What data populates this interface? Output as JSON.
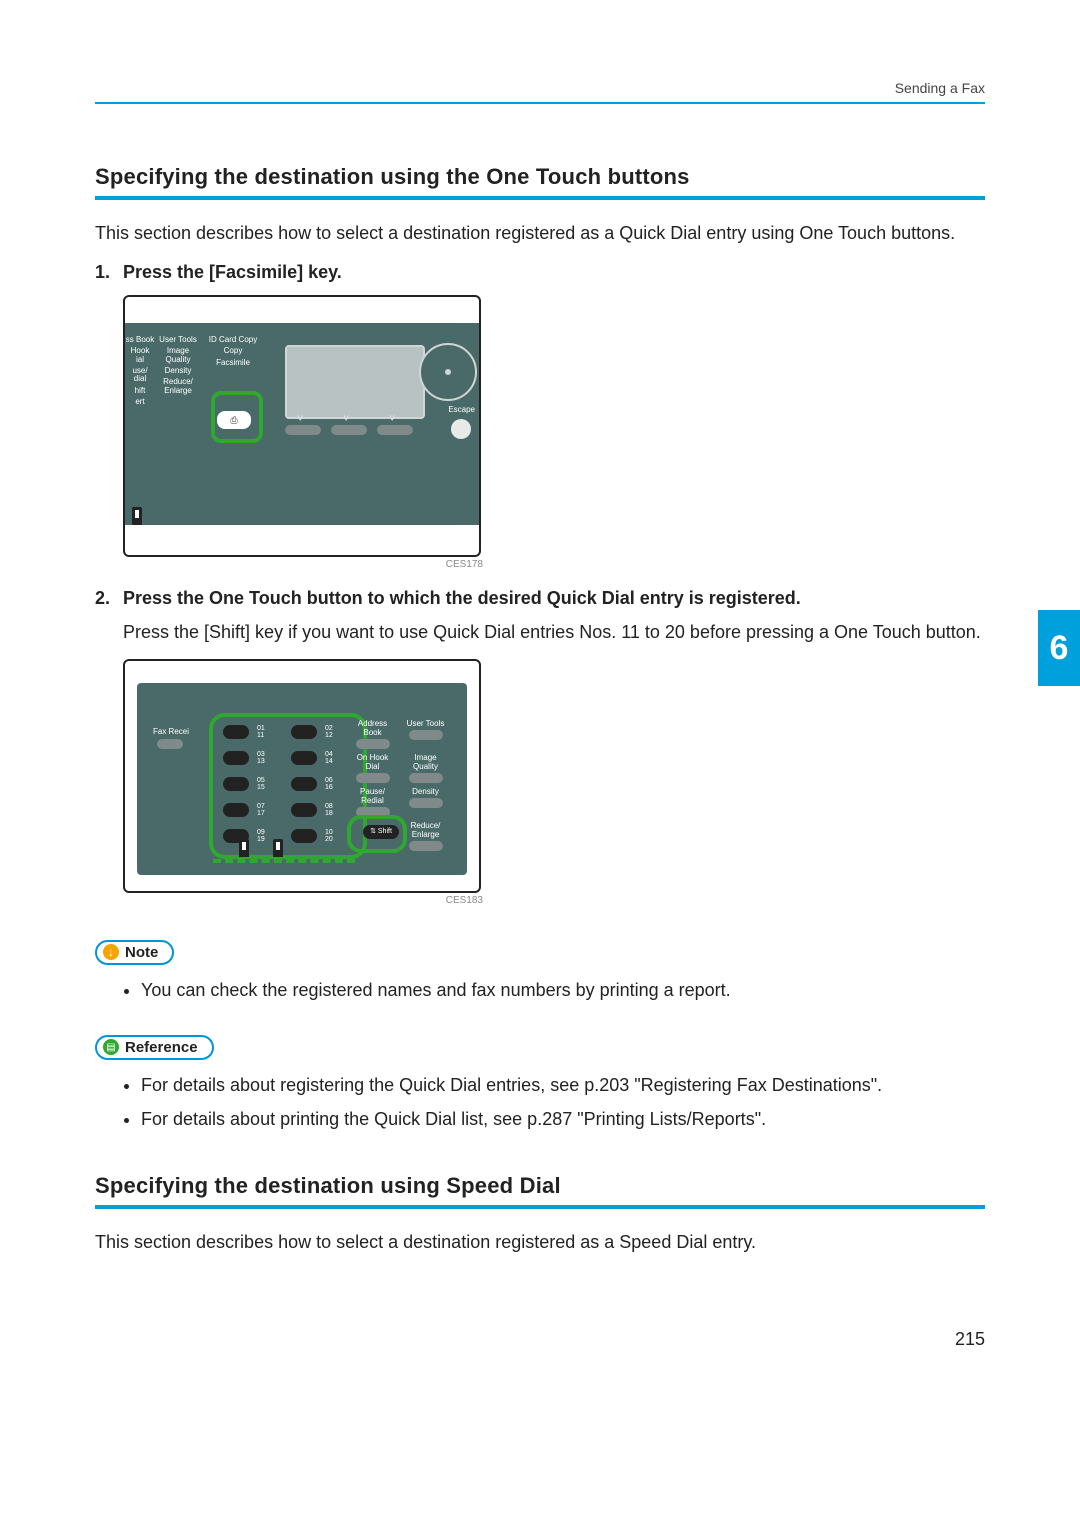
{
  "header": {
    "running": "Sending a Fax"
  },
  "chapterTab": "6",
  "pageNumber": "215",
  "section1": {
    "title": "Specifying the destination using the One Touch buttons",
    "intro": "This section describes how to select a destination registered as a Quick Dial entry using One Touch buttons.",
    "step1": "Press the [Facsimile] key.",
    "fig1caption": "CES178",
    "step2": "Press the One Touch button to which the desired Quick Dial entry is registered.",
    "step2body": "Press the [Shift] key if you want to use Quick Dial entries Nos. 11 to 20 before pressing a One Touch button.",
    "fig2caption": "CES183"
  },
  "labels": {
    "note": "Note",
    "reference": "Reference"
  },
  "noteItems": {
    "i0": "You can check the registered names and fax numbers by printing a report."
  },
  "refItems": {
    "i0": "For details about registering the Quick Dial entries, see p.203 \"Registering Fax Destinations\".",
    "i1": "For details about printing the Quick Dial list, see p.287 \"Printing Lists/Reports\"."
  },
  "section2": {
    "title": "Specifying the destination using Speed Dial",
    "intro": "This section describes how to select a destination registered as a Speed Dial entry."
  },
  "panel1": {
    "col1": {
      "l0": "ss Book",
      "l1": "Hook\nial",
      "l2": "use/\ndial",
      "l3": "hift",
      "l4": "ert"
    },
    "col2": {
      "l0": "User Tools",
      "l1": "Image\nQuality",
      "l2": "Density",
      "l3": "Reduce/\nEnlarge"
    },
    "col3": {
      "l0": "ID Card Copy",
      "l1": "Copy",
      "l2": "Facsimile"
    },
    "escape": "Escape"
  },
  "panel2": {
    "left": "Fax Recei",
    "nums": {
      "r0a": "01\n11",
      "r0b": "02\n12",
      "r1a": "03\n13",
      "r1b": "04\n14",
      "r2a": "05\n15",
      "r2b": "06\n16",
      "r3a": "07\n17",
      "r3b": "08\n18",
      "r4a": "09\n19",
      "r4b": "10\n20"
    },
    "right": {
      "r0a": "Address Book",
      "r0b": "User Tools",
      "r1a": "On Hook\nDial",
      "r1b": "Image\nQuality",
      "r2a": "Pause/\nRedial",
      "r2b": "Density",
      "r3b": "Reduce/\nEnlarge"
    },
    "shift": "Shift"
  }
}
